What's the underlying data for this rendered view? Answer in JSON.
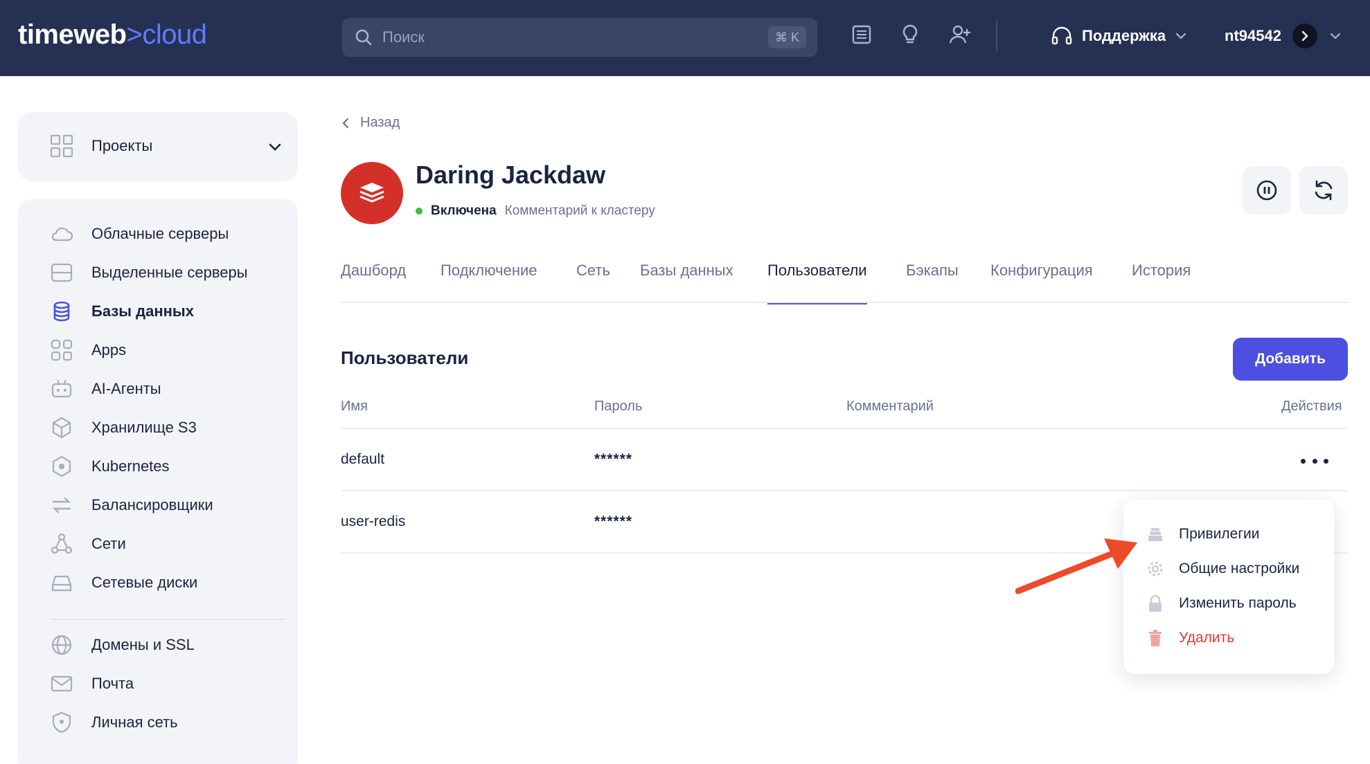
{
  "header": {
    "logo": {
      "main": "timeweb",
      "accent": ">cloud"
    },
    "search": {
      "placeholder": "Поиск",
      "shortcut": "⌘ K"
    },
    "icons": [
      "news-icon",
      "lightbulb-icon",
      "add-user-icon"
    ],
    "support_label": "Поддержка",
    "username": "nt94542"
  },
  "sidebar": {
    "projects_label": "Проекты",
    "items": [
      {
        "label": "Облачные серверы",
        "icon": "cloud-icon"
      },
      {
        "label": "Выделенные серверы",
        "icon": "server-icon"
      },
      {
        "label": "Базы данных",
        "icon": "database-icon",
        "active": true
      },
      {
        "label": "Apps",
        "icon": "apps-icon"
      },
      {
        "label": "AI-Агенты",
        "icon": "robot-icon"
      },
      {
        "label": "Хранилище S3",
        "icon": "cube-icon"
      },
      {
        "label": "Kubernetes",
        "icon": "kubernetes-icon"
      },
      {
        "label": "Балансировщики",
        "icon": "arrows-icon"
      },
      {
        "label": "Сети",
        "icon": "network-icon"
      },
      {
        "label": "Сетевые диски",
        "icon": "disk-icon"
      }
    ],
    "items2": [
      {
        "label": "Домены и SSL",
        "icon": "globe-icon"
      },
      {
        "label": "Почта",
        "icon": "mail-icon"
      },
      {
        "label": "Личная сеть",
        "icon": "shield-icon"
      }
    ]
  },
  "main": {
    "back_label": "Назад",
    "title": "Daring Jackdaw",
    "status": "Включена",
    "comment_link": "Комментарий к кластеру",
    "tabs": [
      {
        "label": "Дашборд"
      },
      {
        "label": "Подключение"
      },
      {
        "label": "Сеть"
      },
      {
        "label": "Базы данных"
      },
      {
        "label": "Пользователи",
        "active": true
      },
      {
        "label": "Бэкапы"
      },
      {
        "label": "Конфигурация"
      },
      {
        "label": "История"
      }
    ],
    "section_title": "Пользователи",
    "add_button": "Добавить",
    "table": {
      "columns": [
        "Имя",
        "Пароль",
        "Комментарий",
        "Действия"
      ],
      "rows": [
        {
          "name": "default",
          "password": "******",
          "comment": ""
        },
        {
          "name": "user-redis",
          "password": "******",
          "comment": ""
        }
      ]
    },
    "dropdown": [
      {
        "label": "Привилегии",
        "icon": "stack-icon"
      },
      {
        "label": "Общие настройки",
        "icon": "gear-icon"
      },
      {
        "label": "Изменить пароль",
        "icon": "lock-icon"
      },
      {
        "label": "Удалить",
        "icon": "trash-icon",
        "danger": true
      }
    ]
  },
  "colors": {
    "topbar": "#263052",
    "accent": "#4c4fe0",
    "brand_accent": "#5b7cff",
    "redis": "#d4302a",
    "status_on": "#3bbf3b",
    "danger": "#e0392f",
    "annotation_arrow": "#ee4a2a"
  }
}
